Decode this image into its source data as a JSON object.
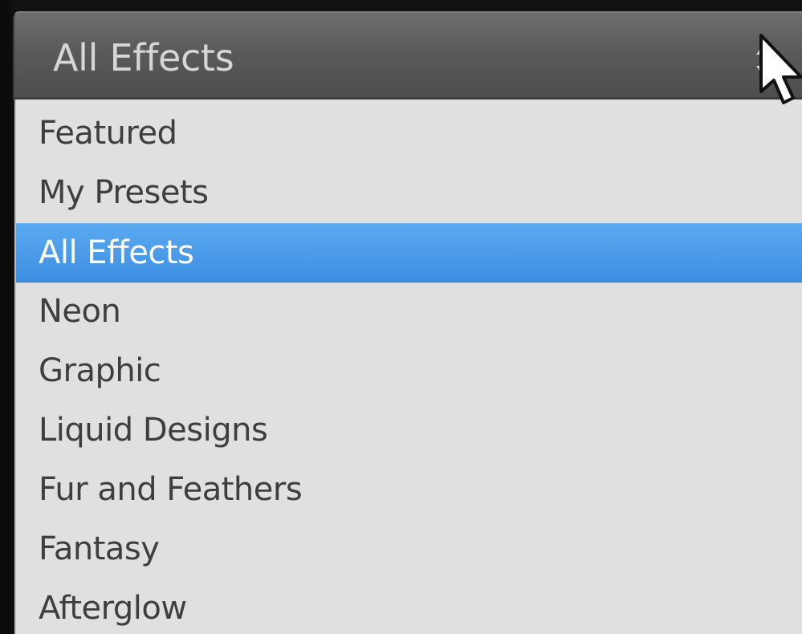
{
  "select": {
    "value": "All Effects",
    "stepper_icon": "up-down-stepper-icon"
  },
  "menu": {
    "items": [
      {
        "label": "Featured",
        "selected": false
      },
      {
        "label": "My Presets",
        "selected": false
      },
      {
        "label": "All Effects",
        "selected": true
      },
      {
        "label": "Neon",
        "selected": false
      },
      {
        "label": "Graphic",
        "selected": false
      },
      {
        "label": "Liquid Designs",
        "selected": false
      },
      {
        "label": "Fur and Feathers",
        "selected": false
      },
      {
        "label": "Fantasy",
        "selected": false
      },
      {
        "label": "Afterglow",
        "selected": false
      }
    ]
  },
  "colors": {
    "selection": "#4a9be8",
    "menu_background": "#e0e0e0",
    "header_background": "#5a5a5a",
    "item_text": "#3e3e3e",
    "header_text": "#d6d6d6"
  },
  "cursor_icon": "mouse-pointer-icon"
}
